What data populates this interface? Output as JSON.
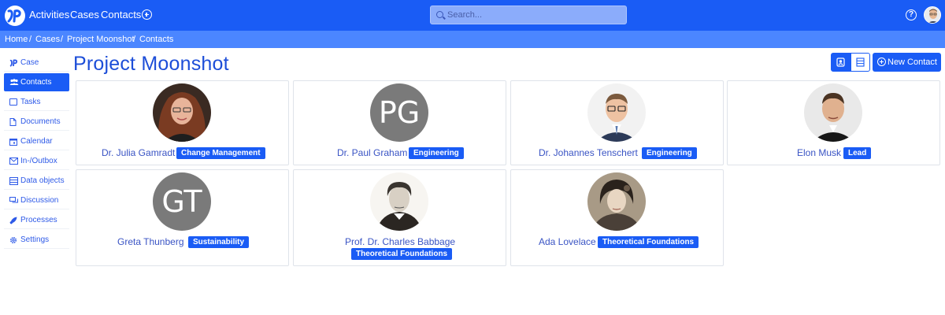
{
  "nav": {
    "links": [
      "Activities",
      "Cases",
      "Contacts"
    ],
    "search_placeholder": "Search...",
    "help_label": "?"
  },
  "breadcrumb": [
    "Home",
    "Cases",
    "Project Moonshot",
    "Contacts"
  ],
  "breadcrumb_separator": "/",
  "sidebar": {
    "items": [
      {
        "label": "Case",
        "icon": "logo-icon"
      },
      {
        "label": "Contacts",
        "icon": "people-icon",
        "active": true
      },
      {
        "label": "Tasks",
        "icon": "tasks-icon"
      },
      {
        "label": "Documents",
        "icon": "document-icon"
      },
      {
        "label": "Calendar",
        "icon": "calendar-icon"
      },
      {
        "label": "In-/Outbox",
        "icon": "envelope-icon"
      },
      {
        "label": "Data objects",
        "icon": "database-icon"
      },
      {
        "label": "Discussion",
        "icon": "chat-icon"
      },
      {
        "label": "Processes",
        "icon": "rocket-icon"
      },
      {
        "label": "Settings",
        "icon": "gear-icon"
      }
    ]
  },
  "page_title": "Project Moonshot",
  "toolbar": {
    "new_contact_label": "New Contact"
  },
  "contacts": [
    {
      "name": "Dr. Julia Gamradt",
      "role": "Change Management",
      "initials": ""
    },
    {
      "name": "Dr. Paul Graham",
      "role": "Engineering",
      "initials": "PG"
    },
    {
      "name": "Dr. Johannes Tenschert",
      "role": "Engineering",
      "initials": ""
    },
    {
      "name": "Elon Musk",
      "role": "Lead",
      "initials": ""
    },
    {
      "name": "Greta Thunberg",
      "role": "Sustainability",
      "initials": "GT"
    },
    {
      "name": "Prof. Dr. Charles Babbage",
      "role": "Theoretical Foundations",
      "initials": ""
    },
    {
      "name": "Ada Lovelace",
      "role": "Theoretical Foundations",
      "initials": ""
    }
  ],
  "colors": {
    "primary": "#1a5cf5",
    "breadcrumb_bg": "#4b86ff",
    "initials_bg": "#7a7a7a"
  }
}
